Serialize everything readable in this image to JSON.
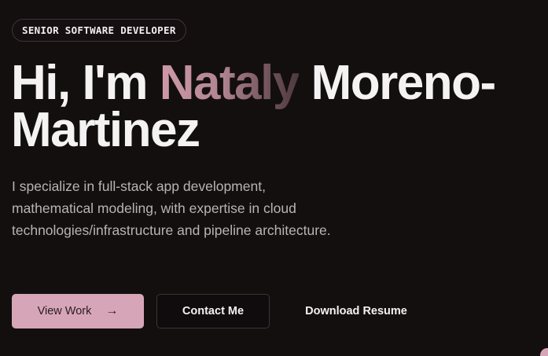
{
  "hero": {
    "badge": "SENIOR SOFTWARE DEVELOPER",
    "headline_prefix": "Hi, I'm ",
    "headline_accent": "Nataly",
    "headline_suffix": " Moreno-Martinez",
    "bio": "I specialize in full-stack app development, mathematical modeling, with expertise in cloud technologies/infrastructure and pipeline architecture.",
    "buttons": {
      "view_work": "View Work",
      "view_work_icon": "arrow-right-icon",
      "contact": "Contact Me",
      "resume": "Download Resume"
    }
  },
  "colors": {
    "background": "#130f0f",
    "accent": "#d6a6b8",
    "text": "#f4f2f3",
    "muted_text": "#b9b3b5"
  }
}
